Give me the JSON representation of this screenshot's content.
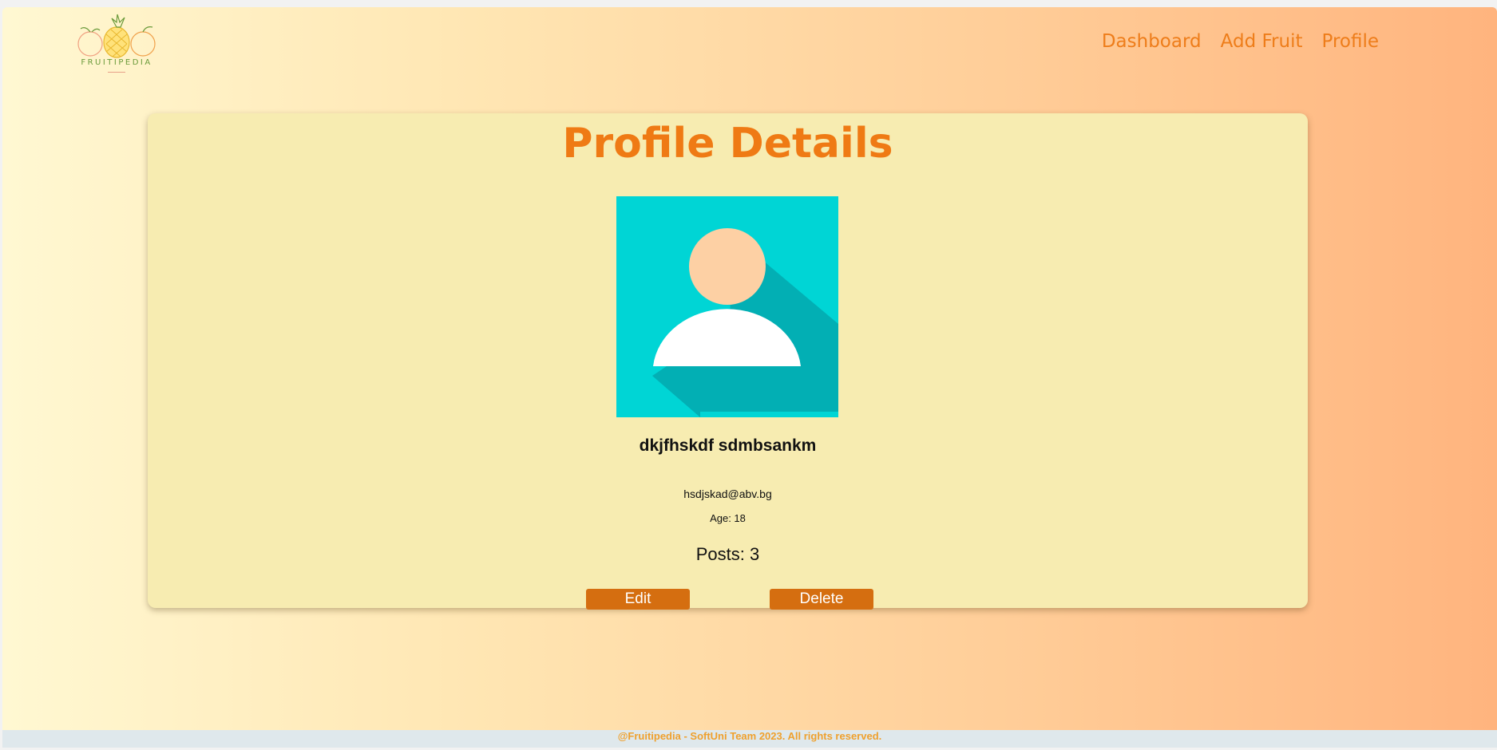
{
  "header": {
    "logo_text": "FRUITIPEDIA",
    "nav": [
      {
        "label": "Dashboard"
      },
      {
        "label": "Add Fruit"
      },
      {
        "label": "Profile"
      }
    ]
  },
  "profile": {
    "title": "Profile Details",
    "avatar": "default-user-avatar",
    "name": "dkjfhskdf sdmbsankm",
    "email": "hsdjskad@abv.bg",
    "age": "Age: 18",
    "posts": "Posts: 3",
    "edit_label": "Edit",
    "delete_label": "Delete"
  },
  "footer": {
    "text": "@Fruitipedia - SoftUni Team 2023. All rights reserved."
  },
  "colors": {
    "accent": "#ef7a14",
    "button": "#d56e10",
    "card": "#f7ecb1",
    "avatar_bg": "#00d5d5",
    "footer_text": "#efa02d"
  }
}
